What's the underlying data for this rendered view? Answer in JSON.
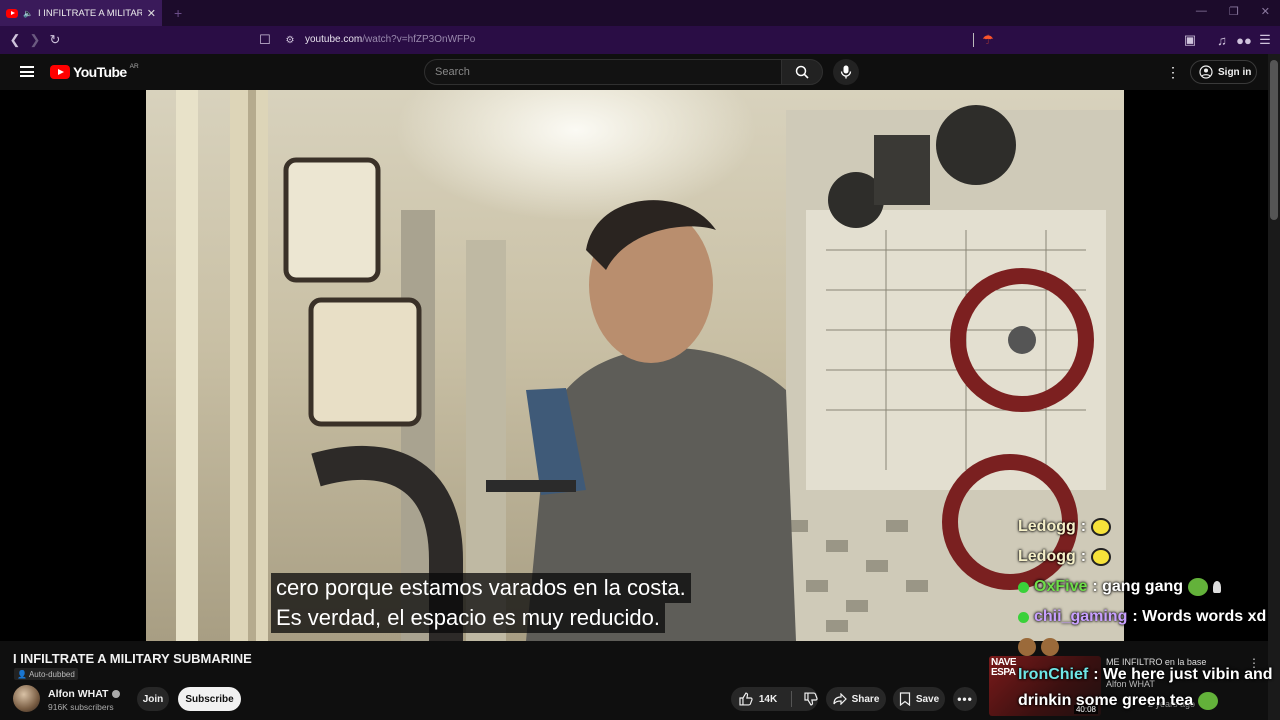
{
  "browser": {
    "tab_title": "I INFILTRATE A MILITARY SUB",
    "url_host": "youtube.com",
    "url_path": "/watch?v=hfZP3OnWFPo"
  },
  "header": {
    "logo_text": "YouTube",
    "country_code": "AR",
    "search_placeholder": "Search",
    "sign_in_label": "Sign in"
  },
  "video": {
    "subtitle_line1": "cero porque estamos varados en la costa.",
    "subtitle_line2": "Es verdad, el espacio es muy reducido.",
    "title": "I INFILTRATE A MILITARY SUBMARINE",
    "auto_dubbed_label": "Auto-dubbed"
  },
  "channel": {
    "name": "Alfon WHAT",
    "subscribers": "916K subscribers",
    "join_label": "Join",
    "subscribe_label": "Subscribe"
  },
  "actions": {
    "likes": "14K",
    "share_label": "Share",
    "save_label": "Save"
  },
  "chat": [
    {
      "user": "Ledogg",
      "text": ":"
    },
    {
      "user": "Ledogg",
      "text": ":"
    },
    {
      "user": "OxFive",
      "text": ": gang gang"
    },
    {
      "user": "chii_gaming",
      "text": ": Words words xd"
    },
    {
      "user": "IronChief",
      "text": ": We here just vibin and"
    },
    {
      "user": "",
      "text": "drinkin some green tea"
    }
  ],
  "endcard": {
    "thumb_label_1": "NAVE",
    "thumb_label_2": "ESPA",
    "duration": "40:08",
    "title": "ME INFILTRO en la base",
    "channel": "Alfon WHAT",
    "date": "2 years ago"
  },
  "colors": {
    "accent_red": "#ff0000",
    "browser_purple": "#2a0d45",
    "chat_green": "#6fde4a",
    "chat_purple": "#c8a0ff"
  }
}
